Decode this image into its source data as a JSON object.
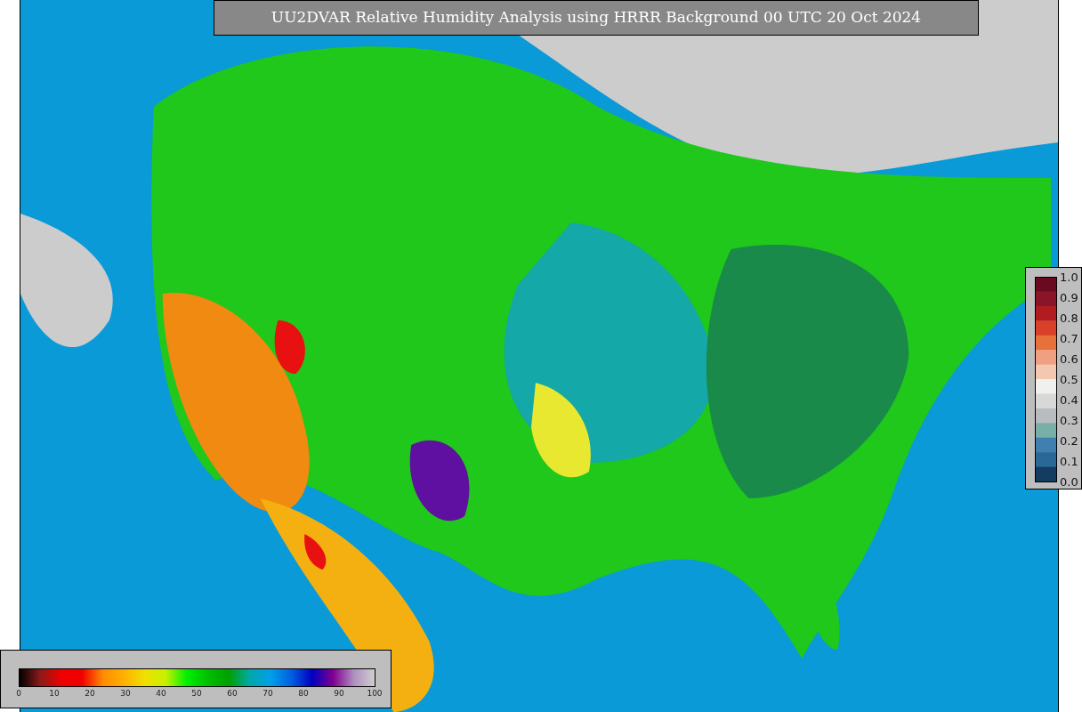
{
  "title": "UU2DVAR Relative Humidity Analysis using HRRR Background 00 UTC 20 Oct 2024",
  "humidity_colorbar": {
    "ticks": [
      "0",
      "10",
      "20",
      "30",
      "40",
      "50",
      "60",
      "70",
      "80",
      "90",
      "100"
    ]
  },
  "station_colorbar": {
    "ticks": [
      "1.0",
      "0.9",
      "0.8",
      "0.7",
      "0.6",
      "0.5",
      "0.4",
      "0.3",
      "0.2",
      "0.1",
      "0.0"
    ]
  }
}
